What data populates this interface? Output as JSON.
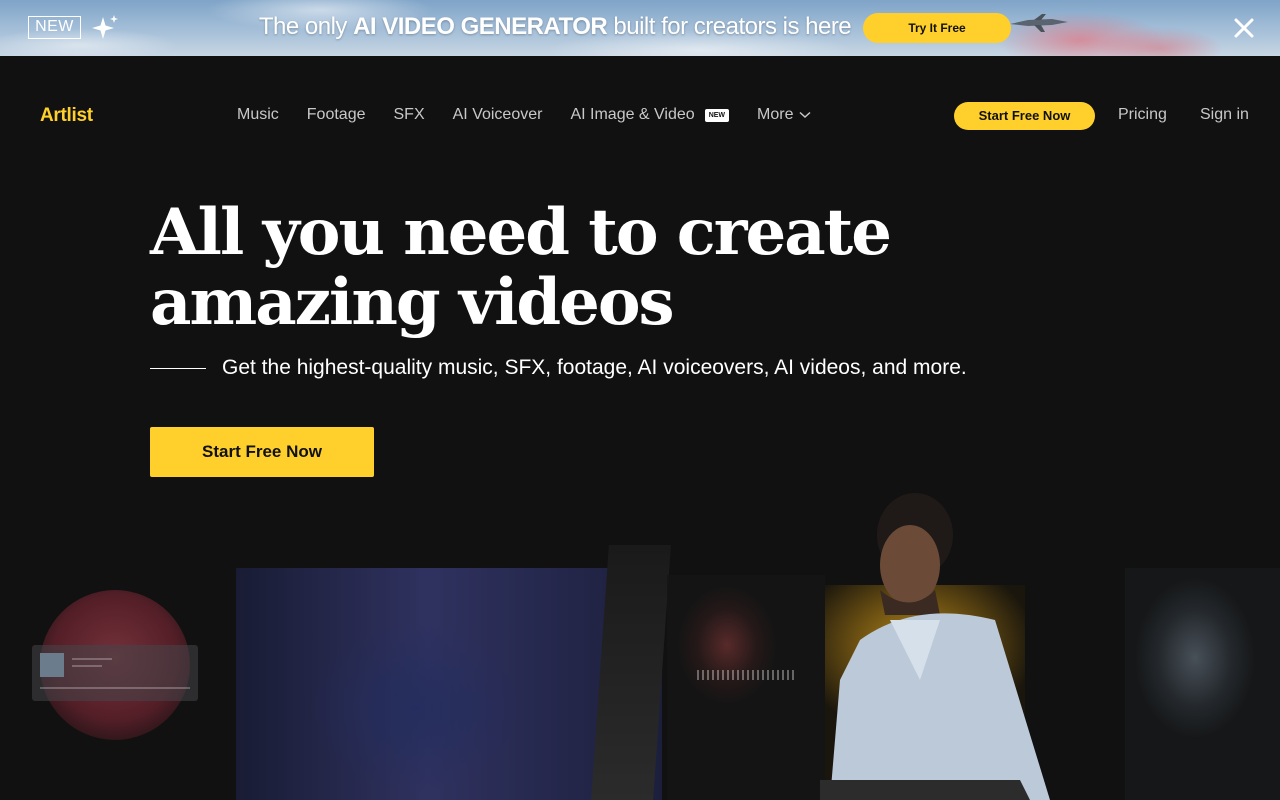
{
  "promo": {
    "new_label": "NEW",
    "text_prefix": "The only ",
    "text_highlight": "AI VIDEO GENERATOR",
    "text_suffix": " built for creators is here",
    "button_label": "Try It Free"
  },
  "nav": {
    "logo": "Artlist",
    "links": [
      {
        "label": "Music"
      },
      {
        "label": "Footage"
      },
      {
        "label": "SFX"
      },
      {
        "label": "AI Voiceover"
      },
      {
        "label": "AI Image & Video",
        "badge": "NEW"
      },
      {
        "label": "More"
      }
    ],
    "cta_label": "Start Free Now",
    "pricing_label": "Pricing",
    "signin_label": "Sign in"
  },
  "hero": {
    "title_line1": "All you need to create",
    "title_line2": "amazing videos",
    "subtitle": "Get the highest-quality music, SFX, footage, AI voiceovers, AI videos, and more.",
    "cta_label": "Start Free Now"
  },
  "colors": {
    "accent": "#ffd02b",
    "background": "#111111",
    "nav_text": "#c8c8c8"
  },
  "icons": {
    "sparkle": "sparkle-icon",
    "close": "close-icon",
    "chevron": "chevron-down-icon"
  }
}
